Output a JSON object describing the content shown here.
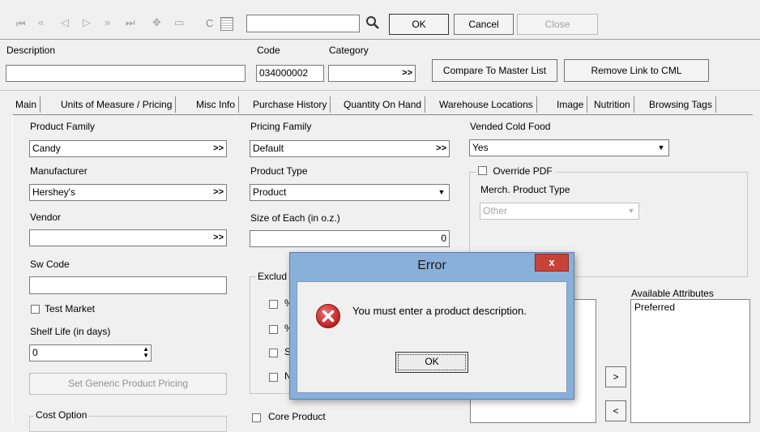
{
  "toolbar": {
    "icons": [
      "first-record-icon",
      "prev-page-icon",
      "prev-record-icon",
      "next-record-icon",
      "next-page-icon",
      "last-record-icon",
      "add-record-icon",
      "delete-record-icon",
      "copy-icon",
      "calculator-icon",
      "search-icon"
    ],
    "nav_first": "⏮",
    "nav_prev_page": "«",
    "nav_prev": "◁",
    "nav_next": "▷",
    "nav_next_page": "»",
    "nav_last": "⏭",
    "add": "✥",
    "delete": "▭",
    "copy": "C",
    "ok_label": "OK",
    "cancel_label": "Cancel",
    "close_label": "Close",
    "search_value": ""
  },
  "header": {
    "description_label": "Description",
    "description_value": "",
    "code_label": "Code",
    "code_value": "034000002",
    "category_label": "Category",
    "category_value": "",
    "category_btn": ">>",
    "compare_button": "Compare To Master List",
    "remove_link_button": "Remove Link to CML"
  },
  "tabs": [
    "Main",
    "Units of Measure / Pricing",
    "Misc Info",
    "Purchase History",
    "Quantity On Hand",
    "Warehouse Locations",
    "Image",
    "Nutrition",
    "Browsing Tags"
  ],
  "main": {
    "product_family_label": "Product Family",
    "product_family_value": "Candy",
    "manufacturer_label": "Manufacturer",
    "manufacturer_value": "Hershey's",
    "vendor_label": "Vendor",
    "vendor_value": "",
    "sw_code_label": "Sw Code",
    "sw_code_value": "",
    "test_market_label": "Test Market",
    "shelf_life_label": "Shelf Life (in days)",
    "shelf_life_value": "0",
    "set_pricing_button": "Set Generic Product Pricing",
    "cost_option_label": "Cost Option",
    "pricing_family_label": "Pricing Family",
    "pricing_family_value": "Default",
    "product_type_label": "Product Type",
    "product_type_value": "Product",
    "size_label": "Size of Each (in o.z.)",
    "size_value": "0",
    "exclude_label": "Exclud",
    "exclude_items": [
      "%",
      "%",
      "S",
      "N"
    ],
    "core_product_label": "Core Product",
    "vended_cold_food_label": "Vended Cold Food",
    "vended_cold_food_value": "Yes",
    "override_pdf_label": "Override PDF",
    "merch_type_label": "Merch. Product Type",
    "merch_type_value": "Other",
    "available_attributes_label": "Available Attributes",
    "available_attributes": [
      "Preferred"
    ],
    "move_right": ">",
    "move_left": "<",
    "btn_more": ">>"
  },
  "dialog": {
    "title": "Error",
    "message": "You must enter a product description.",
    "ok_label": "OK",
    "close_glyph": "x"
  }
}
